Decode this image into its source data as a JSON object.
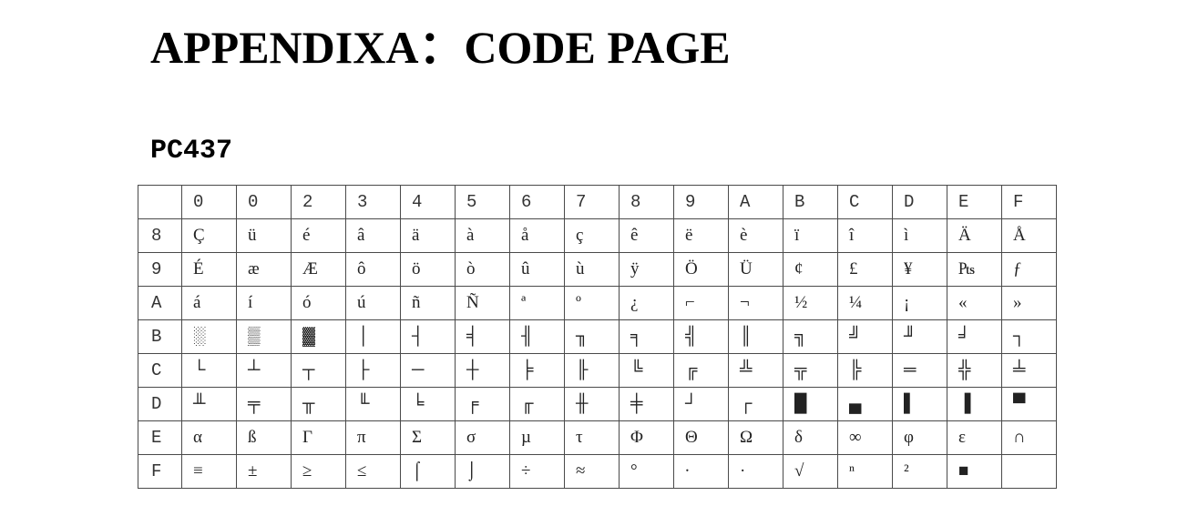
{
  "document": {
    "title": "APPENDIXA：CODE PAGE",
    "section": "PC437"
  },
  "code_table": {
    "column_headers": [
      "0",
      "0",
      "2",
      "3",
      "4",
      "5",
      "6",
      "7",
      "8",
      "9",
      "A",
      "B",
      "C",
      "D",
      "E",
      "F"
    ],
    "rows": [
      {
        "label": "8",
        "cells": [
          "Ç",
          "ü",
          "é",
          "â",
          "ä",
          "à",
          "å",
          "ç",
          "ê",
          "ë",
          "è",
          "ï",
          "î",
          "ì",
          "Ä",
          "Å"
        ]
      },
      {
        "label": "9",
        "cells": [
          "É",
          "æ",
          "Æ",
          "ô",
          "ö",
          "ò",
          "û",
          "ù",
          "ÿ",
          "Ö",
          "Ü",
          "¢",
          "£",
          "¥",
          "₧",
          "ƒ"
        ]
      },
      {
        "label": "A",
        "cells": [
          "á",
          "í",
          "ó",
          "ú",
          "ñ",
          "Ñ",
          "ª",
          "º",
          "¿",
          "⌐",
          "¬",
          "½",
          "¼",
          "¡",
          "«",
          "»"
        ]
      },
      {
        "label": "B",
        "cells": [
          "░",
          "▒",
          "▓",
          "│",
          "┤",
          "╡",
          "╢",
          "╖",
          "╕",
          "╣",
          "║",
          "╗",
          "╝",
          "╜",
          "╛",
          "┐"
        ]
      },
      {
        "label": "C",
        "cells": [
          "└",
          "┴",
          "┬",
          "├",
          "─",
          "┼",
          "╞",
          "╟",
          "╚",
          "╔",
          "╩",
          "╦",
          "╠",
          "═",
          "╬",
          "╧"
        ]
      },
      {
        "label": "D",
        "cells": [
          "╨",
          "╤",
          "╥",
          "╙",
          "╘",
          "╒",
          "╓",
          "╫",
          "╪",
          "┘",
          "┌",
          "█",
          "▄",
          "▌",
          "▐",
          "▀"
        ]
      },
      {
        "label": "E",
        "cells": [
          "α",
          "ß",
          "Γ",
          "π",
          "Σ",
          "σ",
          "µ",
          "τ",
          "Φ",
          "Θ",
          "Ω",
          "δ",
          "∞",
          "φ",
          "ε",
          "∩"
        ]
      },
      {
        "label": "F",
        "cells": [
          "≡",
          "±",
          "≥",
          "≤",
          "⌠",
          "⌡",
          "÷",
          "≈",
          "°",
          "∙",
          "·",
          "√",
          "ⁿ",
          "²",
          "■",
          ""
        ]
      }
    ]
  }
}
